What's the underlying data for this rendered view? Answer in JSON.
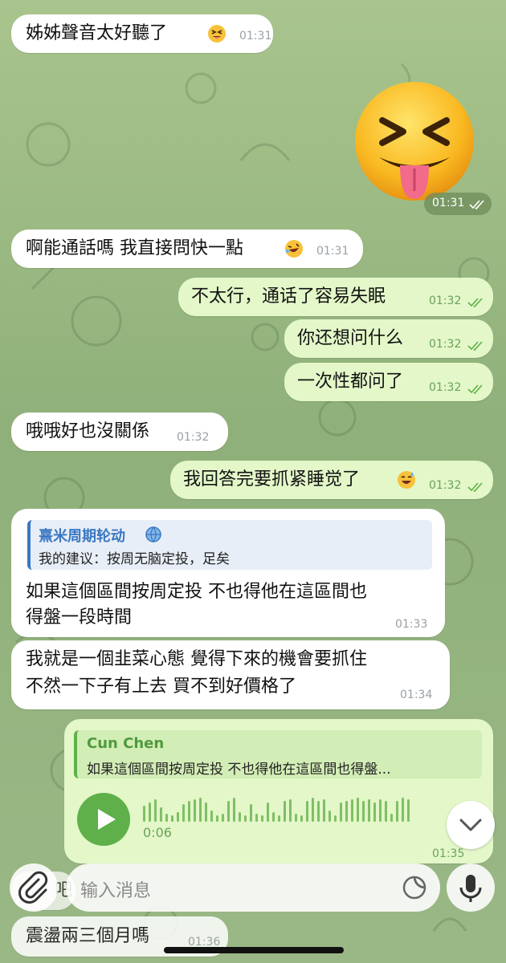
{
  "messages": [
    {
      "id": "m1",
      "text": "姊姊聲音太好聽了",
      "time": "01:31",
      "emoji": "squint-tongue-emoji"
    },
    {
      "id": "m2",
      "sticker": "squinting-face-with-tongue",
      "time": "01:31"
    },
    {
      "id": "m3",
      "text": "啊能通話嗎 我直接問快一點",
      "time": "01:31",
      "emoji": "rolling-laughing-emoji"
    },
    {
      "id": "m4",
      "text": "不太行，通话了容易失眠",
      "time": "01:32"
    },
    {
      "id": "m5",
      "text": "你还想问什么",
      "time": "01:32"
    },
    {
      "id": "m6",
      "text": "一次性都问了",
      "time": "01:32"
    },
    {
      "id": "m7",
      "text": "哦哦好也沒關係",
      "time": "01:32"
    },
    {
      "id": "m8",
      "text": "我回答完要抓紧睡觉了",
      "time": "01:32",
      "emoji": "sweat-smile-emoji"
    },
    {
      "id": "m9",
      "reply": {
        "name": "熹米周期轮动",
        "text": "我的建议：按周无脑定投，足矣"
      },
      "lines": [
        "如果這個區間按周定投 不也得他在這區間也",
        "得盤一段時間"
      ],
      "time": "01:33"
    },
    {
      "id": "m10",
      "lines": [
        "我就是一個韭菜心態 覺得下來的機會要抓住",
        "不然一下子有上去 買不到好價格了"
      ],
      "time": "01:34"
    },
    {
      "id": "m11",
      "reply": {
        "name": "Cun Chen",
        "text": "如果這個區間按周定投 不也得他在這區間也得盤..."
      },
      "voice_duration": "0:06",
      "time": "01:35"
    },
    {
      "id": "m12",
      "text": "震盪兩三個月嗎",
      "time": "01:36"
    }
  ],
  "partial_text": "吧",
  "input": {
    "placeholder": "输入消息"
  },
  "colors": {
    "incoming": "#ffffff",
    "outgoing": "#e3f7c8",
    "accent_green": "#5fb04a",
    "link_blue": "#3a78c2"
  }
}
